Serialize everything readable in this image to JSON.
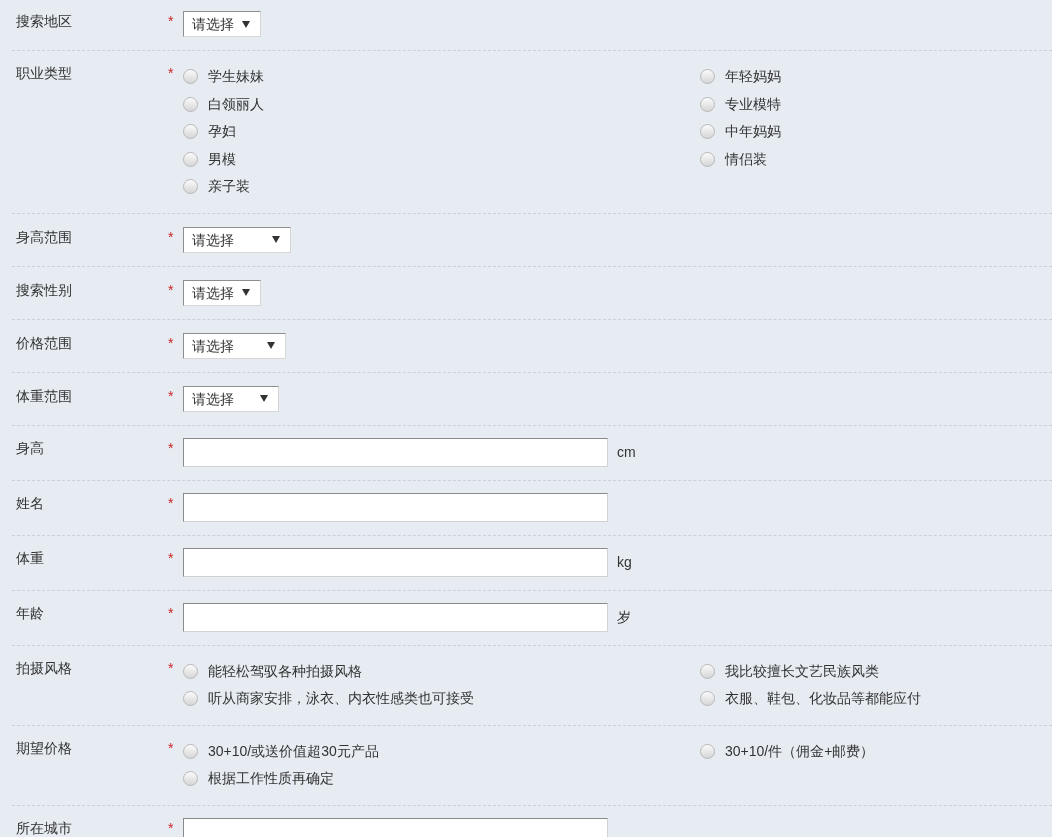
{
  "form": {
    "fields": [
      {
        "label": "搜索地区",
        "required_mark": "*",
        "kind": "select",
        "value": "请选择"
      },
      {
        "label": "职业类型",
        "required_mark": "*",
        "kind": "radio",
        "options": [
          {
            "label": "学生妹妹",
            "selected": false
          },
          {
            "label": "年轻妈妈",
            "selected": false
          },
          {
            "label": "白领丽人",
            "selected": false
          },
          {
            "label": "专业模特",
            "selected": false
          },
          {
            "label": "孕妇",
            "selected": false
          },
          {
            "label": "中年妈妈",
            "selected": false
          },
          {
            "label": "男模",
            "selected": false
          },
          {
            "label": "情侣装",
            "selected": false
          },
          {
            "label": "亲子装",
            "selected": false
          }
        ]
      },
      {
        "label": "身高范围",
        "required_mark": "*",
        "kind": "select",
        "value": "请选择"
      },
      {
        "label": "搜索性别",
        "required_mark": "*",
        "kind": "select",
        "value": "请选择"
      },
      {
        "label": "价格范围",
        "required_mark": "*",
        "kind": "select",
        "value": "请选择"
      },
      {
        "label": "体重范围",
        "required_mark": "*",
        "kind": "select",
        "value": "请选择"
      },
      {
        "label": "身高",
        "required_mark": "*",
        "kind": "text",
        "unit": "cm"
      },
      {
        "label": "姓名",
        "required_mark": "*",
        "kind": "text"
      },
      {
        "label": "体重",
        "required_mark": "*",
        "kind": "text",
        "unit": "kg"
      },
      {
        "label": "年龄",
        "required_mark": "*",
        "kind": "text",
        "unit": "岁"
      },
      {
        "label": "拍摄风格",
        "required_mark": "*",
        "kind": "radio",
        "options": [
          {
            "label": "能轻松驾驭各种拍摄风格",
            "selected": false
          },
          {
            "label": "我比较擅长文艺民族风类",
            "selected": false
          },
          {
            "label": "听从商家安排，泳衣、内衣性感类也可接受",
            "selected": false
          },
          {
            "label": "衣服、鞋包、化妆品等都能应付",
            "selected": false
          }
        ]
      },
      {
        "label": "期望价格",
        "required_mark": "*",
        "kind": "radio",
        "options": [
          {
            "label": "30+10/或送价值超30元产品",
            "selected": false
          },
          {
            "label": "30+10/件（佣金+邮费）",
            "selected": false
          },
          {
            "label": "根据工作性质再确定",
            "selected": false
          }
        ]
      },
      {
        "label": "所在城市",
        "required_mark": "*",
        "kind": "text"
      }
    ]
  }
}
